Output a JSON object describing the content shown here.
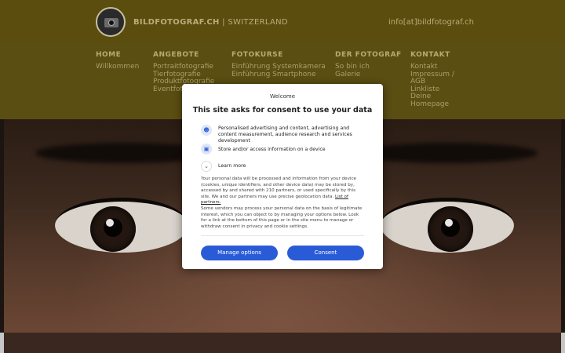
{
  "header": {
    "brand_name": "BILDFOTOGRAF.CH",
    "brand_separator": " | ",
    "brand_region": "SWITZERLAND",
    "email": "info[at]bildfotograf.ch"
  },
  "nav": [
    {
      "heading": "HOME",
      "links": [
        "Willkommen"
      ]
    },
    {
      "heading": "ANGEBOTE",
      "links": [
        "Portraitfotografie",
        "Tierfotografie",
        "Produktfotografie",
        "Eventfotografie"
      ]
    },
    {
      "heading": "FOTOKURSE",
      "links": [
        "Einführung Systemkamera",
        "Einführung Smartphone"
      ]
    },
    {
      "heading": "DER FOTOGRAF",
      "links": [
        "So bin ich",
        "Galerie"
      ]
    },
    {
      "heading": "KONTAKT",
      "links": [
        "Kontakt",
        "Impressum /",
        "AGB",
        "Linkliste",
        "Deine",
        "Homepage"
      ]
    }
  ],
  "consent": {
    "welcome": "Welcome",
    "title": "This site asks for consent to use your data",
    "purposes": [
      {
        "icon": "person-icon",
        "text": "Personalised advertising and content, advertising and content measurement, audience research and services development"
      },
      {
        "icon": "device-icon",
        "text": "Store and/or access information on a device"
      }
    ],
    "learn_more": "Learn more",
    "body1": "Your personal data will be processed and information from your device (cookies, unique identifiers, and other device data) may be stored by, accessed by and shared with 210 partners, or used specifically by this site. We and our partners may use precise geolocation data. ",
    "partners_link": "List of partners.",
    "body2": "Some vendors may process your personal data on the basis of legitimate interest, which you can object to by managing your options below. Look for a link at the bottom of this page or in the site menu to manage or withdraw consent in privacy and cookie settings.",
    "manage_label": "Manage options",
    "consent_label": "Consent",
    "accent": "#2a5bd7"
  }
}
